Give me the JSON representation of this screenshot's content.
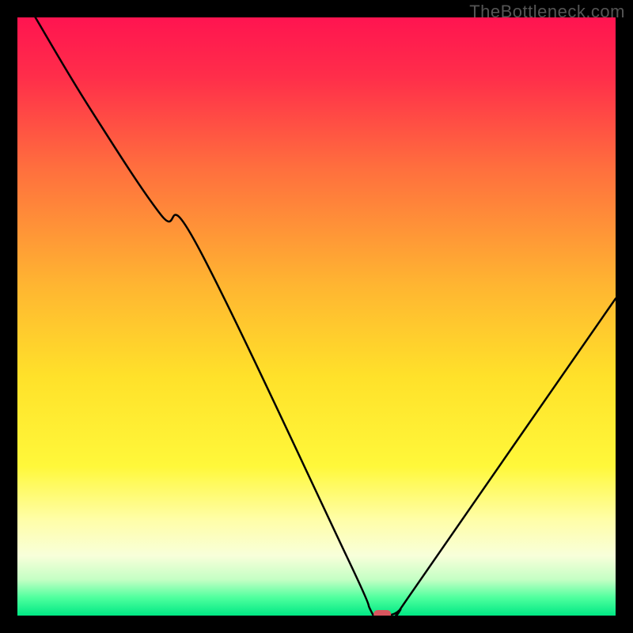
{
  "watermark": "TheBottleneck.com",
  "chart_data": {
    "type": "line",
    "title": "",
    "xlabel": "",
    "ylabel": "",
    "xlim": [
      0,
      100
    ],
    "ylim": [
      0,
      100
    ],
    "x": [
      3,
      12,
      24,
      30,
      55,
      59,
      60,
      62,
      64,
      66,
      100
    ],
    "values": [
      100,
      85,
      67,
      62,
      10,
      1,
      0,
      0,
      1,
      4,
      53
    ],
    "marker": {
      "x": 61,
      "y": 0,
      "color": "#d9565f"
    },
    "gradient_stops": [
      {
        "offset": 0.0,
        "color": "#ff1450"
      },
      {
        "offset": 0.1,
        "color": "#ff2e4a"
      },
      {
        "offset": 0.25,
        "color": "#ff6e3e"
      },
      {
        "offset": 0.45,
        "color": "#ffb631"
      },
      {
        "offset": 0.6,
        "color": "#ffe12a"
      },
      {
        "offset": 0.75,
        "color": "#fff83a"
      },
      {
        "offset": 0.84,
        "color": "#fffea8"
      },
      {
        "offset": 0.9,
        "color": "#f8ffda"
      },
      {
        "offset": 0.94,
        "color": "#c4ffc4"
      },
      {
        "offset": 0.97,
        "color": "#4fff9e"
      },
      {
        "offset": 1.0,
        "color": "#00e884"
      }
    ]
  }
}
